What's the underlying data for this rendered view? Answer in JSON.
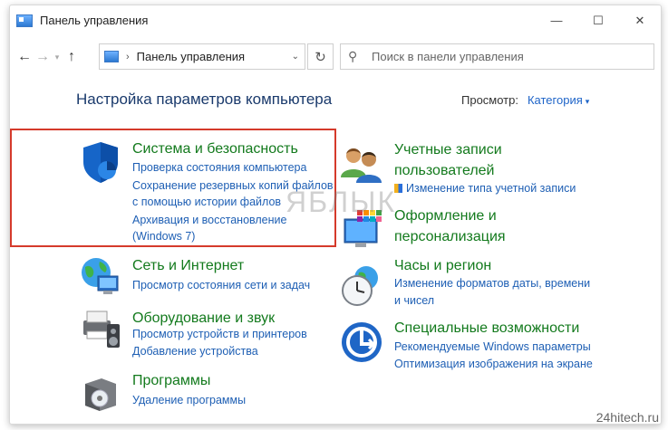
{
  "window": {
    "title": "Панель управления",
    "controls": {
      "minimize": "—",
      "maximize": "☐",
      "close": "✕"
    }
  },
  "address_bar": {
    "breadcrumb": "Панель управления",
    "search_placeholder": "Поиск в панели управления"
  },
  "main": {
    "heading": "Настройка параметров компьютера",
    "view_label": "Просмотр:",
    "view_value": "Категория"
  },
  "categories": {
    "system": {
      "title": "Система и безопасность",
      "links": [
        "Проверка состояния компьютера",
        "Сохранение резервных копий файлов",
        "с помощью истории файлов",
        "Архивация и восстановление",
        "(Windows 7)"
      ]
    },
    "network": {
      "title": "Сеть и Интернет",
      "links": [
        "Просмотр состояния сети и задач"
      ]
    },
    "hardware": {
      "title": "Оборудование и звук",
      "links": [
        "Просмотр устройств и принтеров",
        "Добавление устройства"
      ]
    },
    "programs": {
      "title": "Программы",
      "links": [
        "Удаление программы"
      ]
    },
    "accounts": {
      "title_line1": "Учетные записи",
      "title_line2": "пользователей",
      "links": [
        "Изменение типа учетной записи"
      ]
    },
    "appearance": {
      "title_line1": "Оформление и",
      "title_line2": "персонализация",
      "links": []
    },
    "clock": {
      "title": "Часы и регион",
      "links": [
        "Изменение форматов даты, времени",
        "и чисел"
      ]
    },
    "access": {
      "title": "Специальные возможности",
      "links": [
        "Рекомендуемые Windows параметры",
        "Оптимизация изображения на экране"
      ]
    }
  },
  "watermark": "ЯБЛЫК",
  "credit": "24hitech.ru",
  "colors": {
    "category_title": "#137a1d",
    "link": "#1e5fb4",
    "highlight_border": "#d53a2b"
  }
}
